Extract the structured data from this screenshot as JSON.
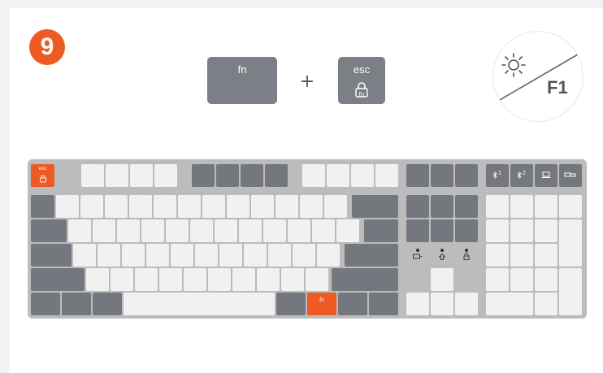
{
  "step": {
    "number": "9"
  },
  "shortcut": {
    "key1_label": "fn",
    "plus": "+",
    "key2_label": "esc",
    "key2_sublabel": "fn"
  },
  "badge": {
    "label": "F1",
    "icon": "brightness-sun-icon"
  },
  "keyboard": {
    "esc_label": "esc",
    "esc_sublabel": "fn",
    "fn_label": "fn",
    "bt1_label": "1",
    "bt2_label": "2"
  },
  "colors": {
    "accent": "#ee5a24",
    "dark_key": "#74777e",
    "light_key": "#f1f1f1",
    "board": "#bcbcbc"
  }
}
